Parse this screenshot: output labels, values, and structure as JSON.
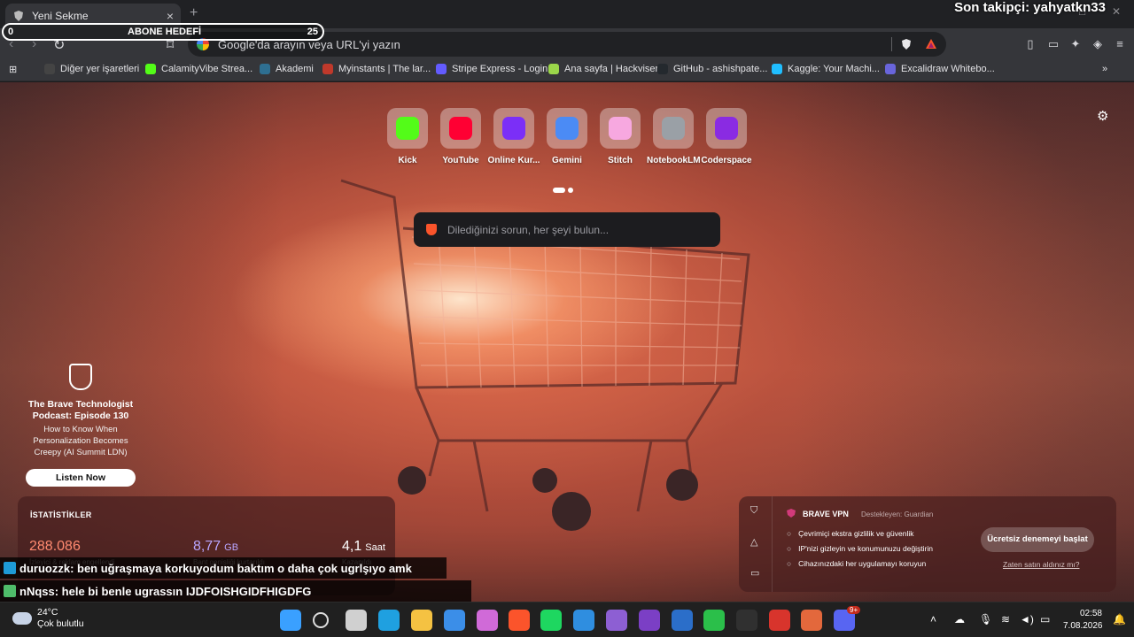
{
  "browser": {
    "tab": {
      "title": "Yeni Sekme",
      "close": "×"
    },
    "new_tab": "+",
    "window_controls": {
      "minimize": "—",
      "maximize": "□",
      "close": "✕"
    },
    "omnibox": {
      "placeholder": "Google'da arayın veya URL'yi yazın"
    }
  },
  "overlay": {
    "follower": "Son takipçi: yahyatkn33",
    "goal": {
      "label": "ABONE HEDEFİ",
      "min": "0",
      "max": "25"
    }
  },
  "bookmarks": [
    {
      "label": "Diğer yer işaretleri",
      "color": "#444"
    },
    {
      "label": "CalamityVibe Strea...",
      "color": "#53fc18"
    },
    {
      "label": "Akademi",
      "color": "#2e6f91"
    },
    {
      "label": "Myinstants | The lar...",
      "color": "#c0392b"
    },
    {
      "label": "Stripe Express - Login",
      "color": "#635bff"
    },
    {
      "label": "Ana sayfa | Hackviser",
      "color": "#9bd64a"
    },
    {
      "label": "GitHub - ashishpate...",
      "color": "#24292e"
    },
    {
      "label": "Kaggle: Your Machi...",
      "color": "#20beff"
    },
    {
      "label": "Excalidraw Whitebo...",
      "color": "#6965db"
    }
  ],
  "newtab": {
    "top_sites": [
      {
        "label": "Kick",
        "color": "#53fc18"
      },
      {
        "label": "YouTube",
        "color": "#ff0033"
      },
      {
        "label": "Online Kur...",
        "color": "#7b2ff7"
      },
      {
        "label": "Gemini",
        "color": "#4b8bf5"
      },
      {
        "label": "Stitch",
        "color": "#f7a8e0"
      },
      {
        "label": "NotebookLM",
        "color": "#9aa0a6"
      },
      {
        "label": "Coderspace",
        "color": "#8a2be2"
      }
    ],
    "search_placeholder": "Dilediğinizi sorun, her şeyi bulun...",
    "promo": {
      "title": "The Brave Technologist Podcast: Episode 130",
      "subtitle": "How to Know When Personalization Becomes Creepy (AI Summit LDN)",
      "button": "Listen Now"
    },
    "stats": {
      "header": "İSTATİSTİKLER",
      "items": [
        {
          "value": "288.086",
          "unit": "",
          "caption": "İzleyici & reklam engellendi",
          "color": "#ff8a70"
        },
        {
          "value": "8,77",
          "unit": "GB",
          "caption": "Bant genişliği kurtarıldı",
          "color": "#b9a6ff"
        },
        {
          "value": "4,1",
          "unit": "Saat",
          "caption": "Kazanıldı",
          "color": "#ffffff"
        }
      ]
    },
    "vpn": {
      "title": "BRAVE VPN",
      "by": "Destekleyen: Guardian",
      "features": [
        "Çevrimiçi ekstra gizlilik ve güvenlik",
        "IP'nizi gizleyin ve konumunuzu değiştirin",
        "Cihazınızdaki her uygulamayı koruyun"
      ],
      "cta": "Ücretsiz denemeyi başlat",
      "already": "Zaten satın aldınız mı?"
    }
  },
  "chat": [
    {
      "user": "duruozzk",
      "message": " : ben uğraşmaya korkuyodum baktım o daha çok ugrlşıyo amk"
    },
    {
      "user": "nNqss",
      "message": " : hele bi benle ugrassın IJDFOISHGIDFHIGDFG"
    }
  ],
  "taskbar": {
    "weather": {
      "temp": "24°C",
      "desc": "Çok bulutlu"
    },
    "clock": {
      "time": "02:58",
      "date": "7.08.2026"
    },
    "apps": [
      {
        "name": "windows-start",
        "color": "#3aa0ff"
      },
      {
        "name": "search",
        "color": "#202020"
      },
      {
        "name": "task-view",
        "color": "#d0d0d0"
      },
      {
        "name": "edge",
        "color": "#1fa0e0"
      },
      {
        "name": "file-explorer",
        "color": "#f5c242"
      },
      {
        "name": "store",
        "color": "#3b8ee8"
      },
      {
        "name": "copilot-365",
        "color": "#d06ad8"
      },
      {
        "name": "brave",
        "color": "#fb542b"
      },
      {
        "name": "spotify",
        "color": "#1ed760"
      },
      {
        "name": "vscode",
        "color": "#2f8ee0"
      },
      {
        "name": "visual-studio",
        "color": "#8d5fd3"
      },
      {
        "name": "onenote-n",
        "color": "#7b3fc5"
      },
      {
        "name": "arc-a",
        "color": "#2b6ec9"
      },
      {
        "name": "loader-green",
        "color": "#2bbf4a"
      },
      {
        "name": "obs",
        "color": "#303030"
      },
      {
        "name": "red-app",
        "color": "#d8342c"
      },
      {
        "name": "sparkle-app",
        "color": "#e3683c"
      },
      {
        "name": "discord",
        "color": "#5865f2"
      }
    ],
    "discord_badge": "9+"
  }
}
